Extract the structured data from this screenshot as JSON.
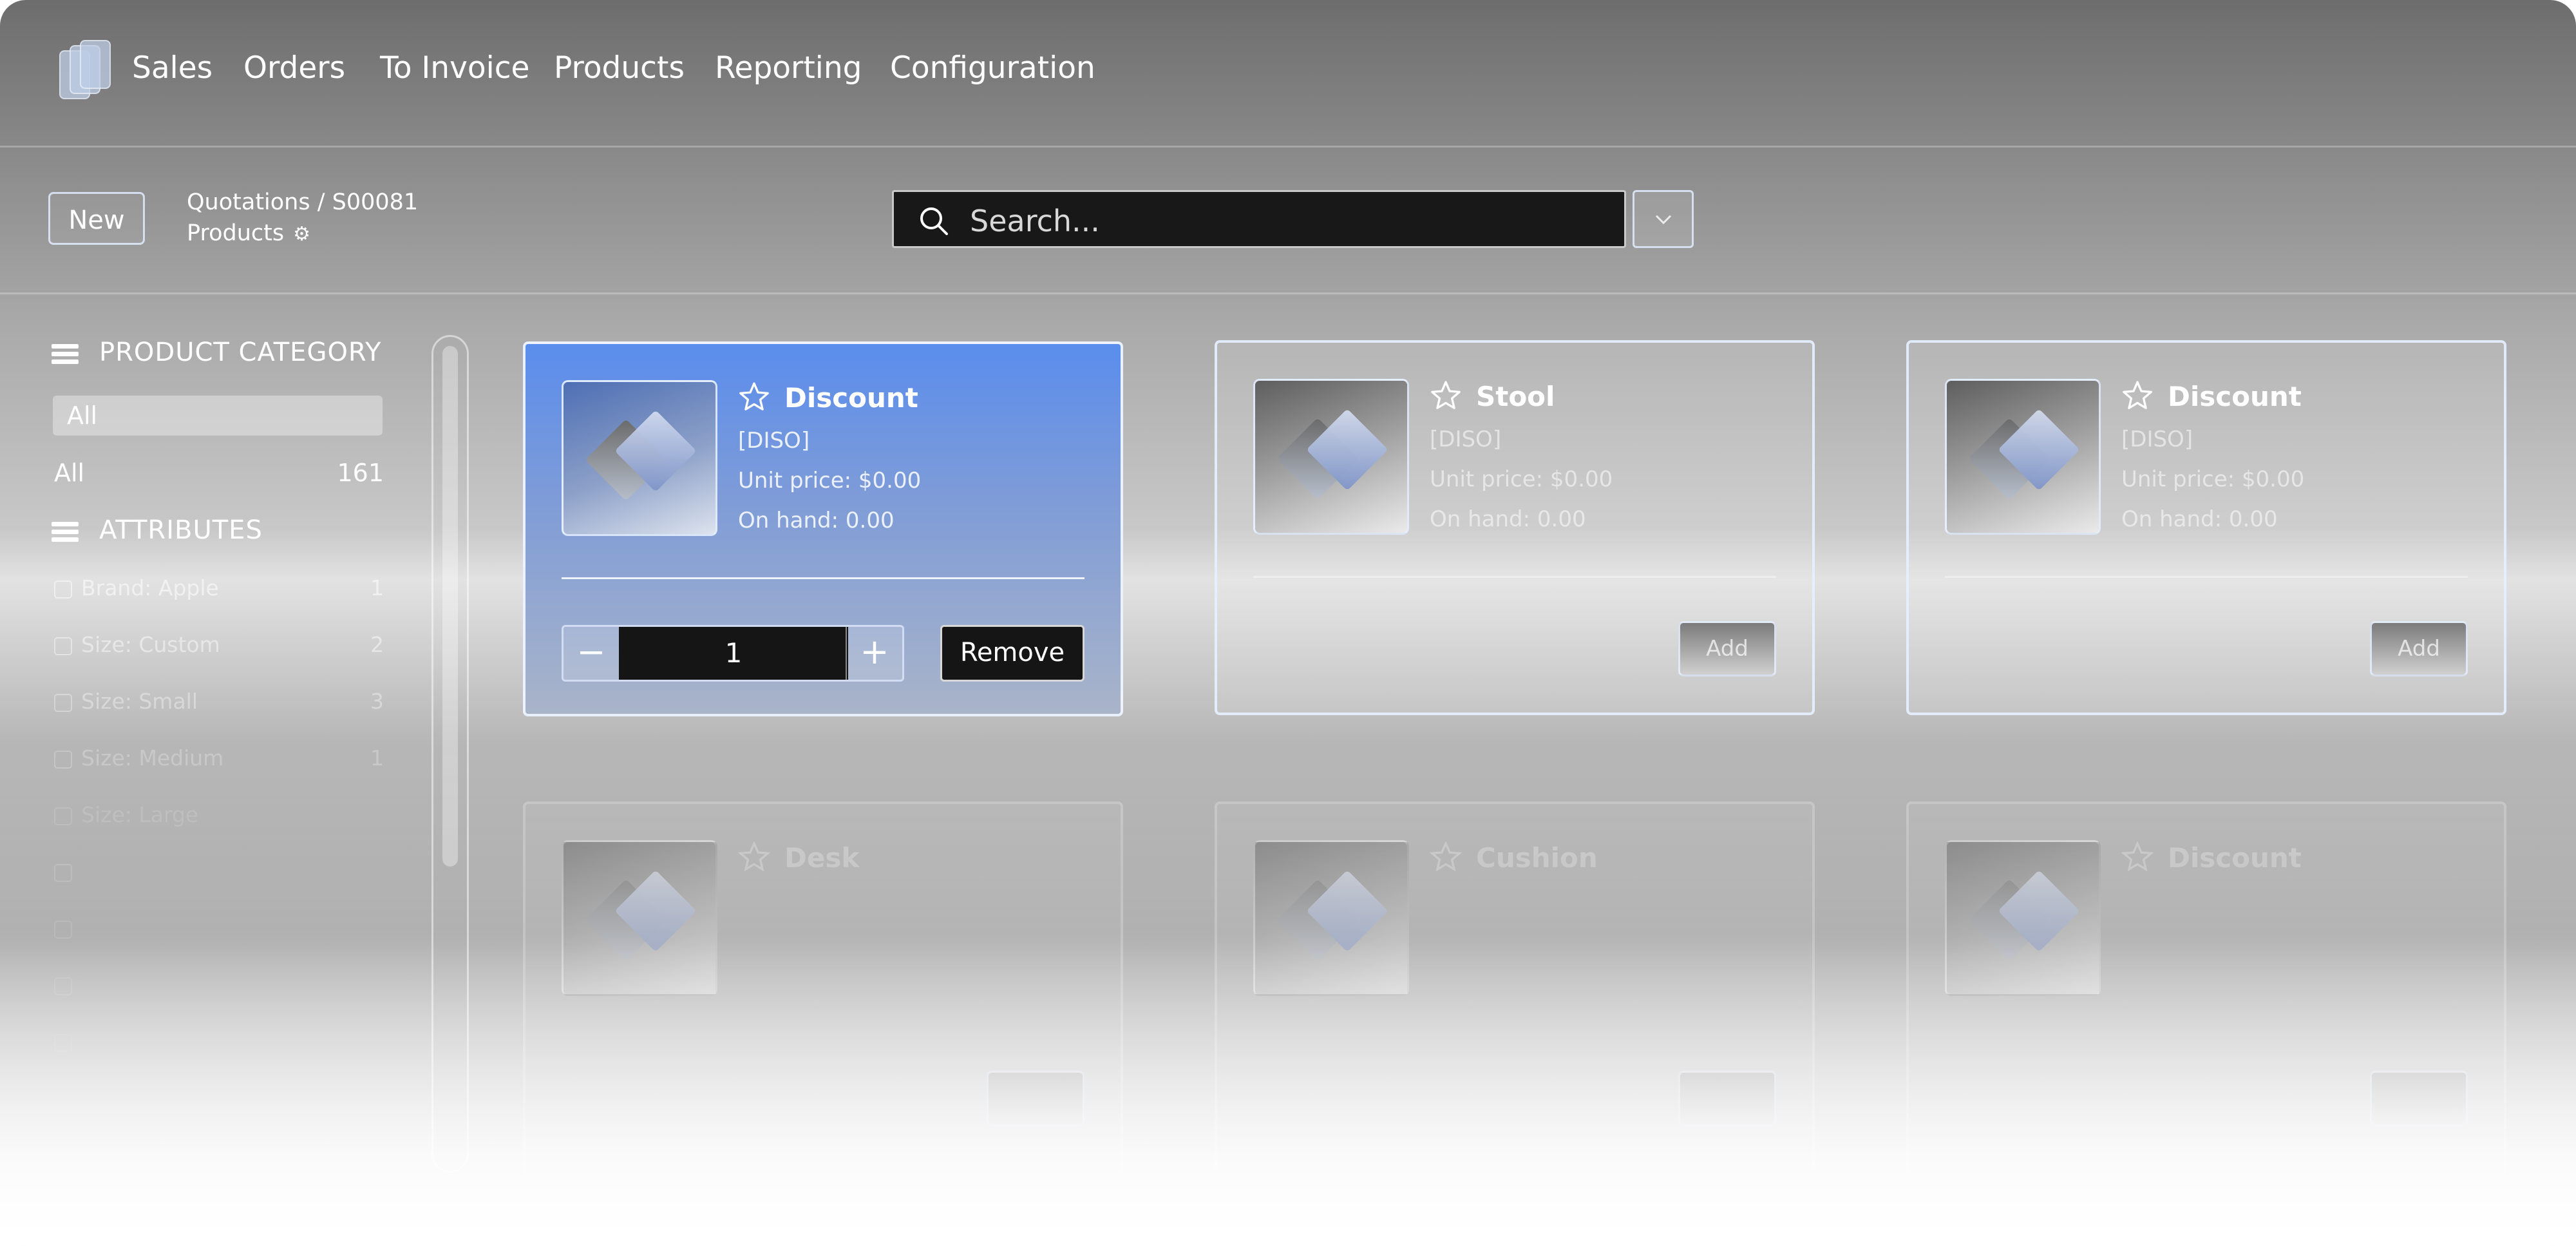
{
  "nav": {
    "items": [
      "Sales",
      "Orders",
      "To Invoice",
      "Products",
      "Reporting",
      "Configuration"
    ]
  },
  "control": {
    "new_label": "New",
    "breadcrumb_parent": "Quotations / S00081",
    "breadcrumb_current": "Products",
    "search_placeholder": "Search..."
  },
  "sidebar": {
    "category_heading": "PRODUCT CATEGORY",
    "filter_value": "All",
    "category": {
      "label": "All",
      "count": "161"
    },
    "attributes_heading": "ATTRIBUTES",
    "attributes": [
      {
        "label": "Brand: Apple",
        "count": "1"
      },
      {
        "label": "Size: Custom",
        "count": "2"
      },
      {
        "label": "Size: Small",
        "count": "3"
      },
      {
        "label": "Size: Medium",
        "count": "1"
      },
      {
        "label": "Size: Large",
        "count": ""
      }
    ]
  },
  "products": [
    {
      "title": "Discount",
      "code": "[DISO]",
      "price": "Unit price: $0.00",
      "onhand": "On hand: 0.00",
      "qty": "1",
      "remove": "Remove"
    },
    {
      "title": "Stool",
      "code": "[DISO]",
      "price": "Unit price: $0.00",
      "onhand": "On hand: 0.00",
      "add": "Add"
    },
    {
      "title": "Discount",
      "code": "[DISO]",
      "price": "Unit price: $0.00",
      "onhand": "On hand: 0.00",
      "add": "Add"
    },
    {
      "title": "Desk"
    },
    {
      "title": "Cushion"
    },
    {
      "title": "Discount"
    }
  ],
  "colors": {
    "selected_card": "#5a8ded",
    "search_bg": "#181818"
  }
}
